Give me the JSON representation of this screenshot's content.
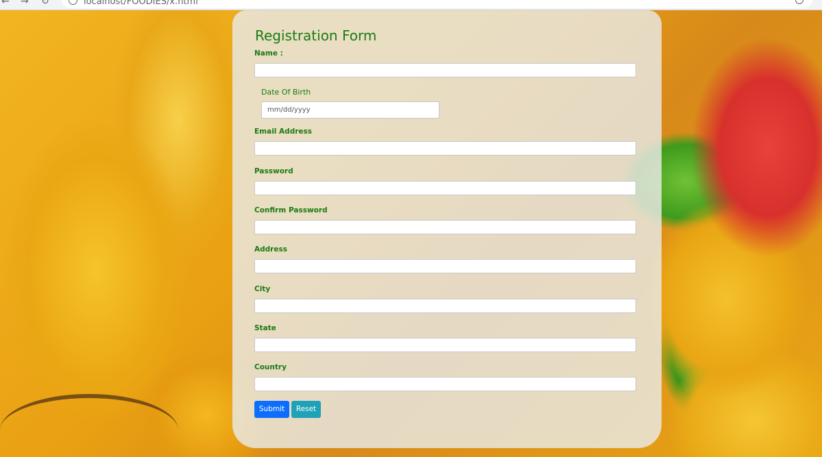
{
  "browser": {
    "url": "localhost/FOODIES/x.html"
  },
  "form": {
    "title": "Registration Form",
    "name_label": "Name :",
    "dob_label": "Date Of Birth",
    "dob_placeholder": "mm/dd/yyyy",
    "email_label": "Email Address",
    "password_label": "Password",
    "confirm_password_label": "Confirm Password",
    "address_label": "Address",
    "city_label": "City",
    "state_label": "State",
    "country_label": "Country",
    "submit_label": "Submit",
    "reset_label": "Reset"
  },
  "colors": {
    "label_green": "#1b7a12",
    "submit_blue": "#0d6efd",
    "reset_teal": "#1ea2b8"
  }
}
